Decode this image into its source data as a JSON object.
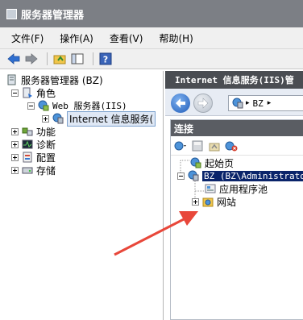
{
  "window": {
    "title": "服务器管理器"
  },
  "menu": {
    "items": [
      "文件(F)",
      "操作(A)",
      "查看(V)",
      "帮助(H)"
    ]
  },
  "tree": {
    "root": "服务器管理器 (BZ)",
    "roles": "角色",
    "web_server": "Web 服务器(IIS)",
    "iis": "Internet 信息服务(",
    "features": "功能",
    "diagnostics": "诊断",
    "configuration": "配置",
    "storage": "存储"
  },
  "right": {
    "header": "Internet 信息服务(IIS)管",
    "address": "BZ",
    "connections": {
      "title": "连接",
      "start_page": "起始页",
      "server": "BZ (BZ\\Administrator",
      "app_pools": "应用程序池",
      "sites": "网站"
    }
  },
  "colors": {
    "arrow": "#e8473a",
    "selection": "#0a246a",
    "header": "#4a4d52"
  }
}
